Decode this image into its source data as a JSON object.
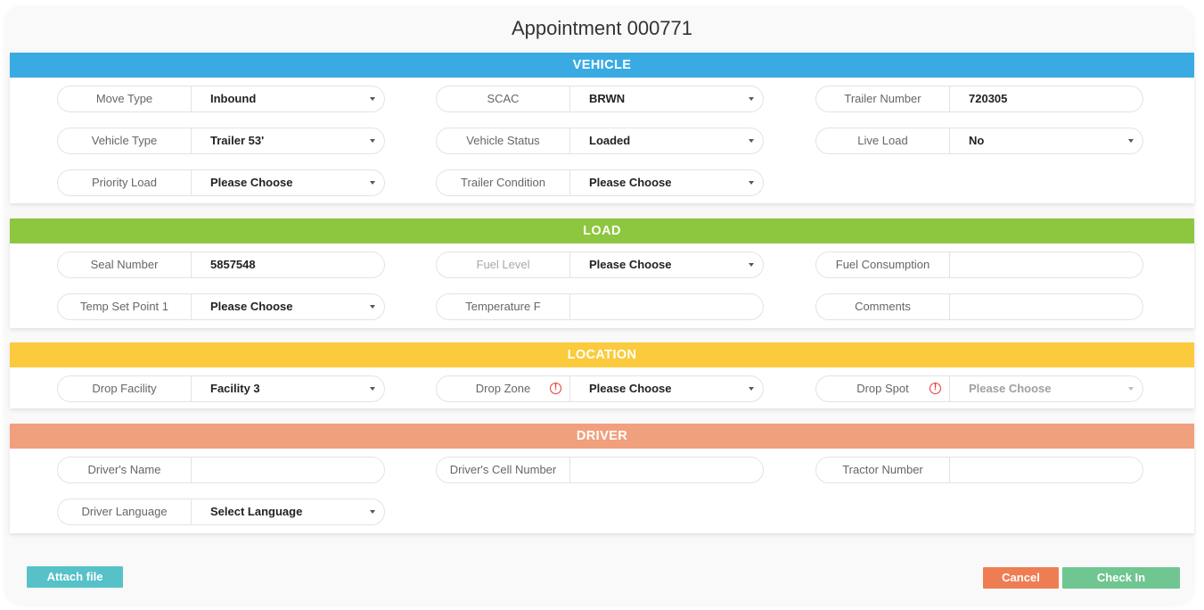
{
  "title": "Appointment 000771",
  "colors": {
    "vehicle": "#3aabe2",
    "load": "#8dc63f",
    "location": "#fbcb3d",
    "driver": "#f1a07e",
    "attach": "#56c2c8",
    "cancel": "#ef7d53",
    "checkin": "#6fc690"
  },
  "sections": {
    "vehicle": {
      "header": "VEHICLE",
      "move_type": {
        "label": "Move Type",
        "value": "Inbound"
      },
      "scac": {
        "label": "SCAC",
        "value": "BRWN"
      },
      "trailer_number": {
        "label": "Trailer Number",
        "value": "720305"
      },
      "vehicle_type": {
        "label": "Vehicle Type",
        "value": "Trailer 53'"
      },
      "vehicle_status": {
        "label": "Vehicle Status",
        "value": "Loaded"
      },
      "live_load": {
        "label": "Live Load",
        "value": "No"
      },
      "priority_load": {
        "label": "Priority Load",
        "value": "Please Choose"
      },
      "trailer_condition": {
        "label": "Trailer Condition",
        "value": "Please Choose"
      }
    },
    "load": {
      "header": "LOAD",
      "seal_number": {
        "label": "Seal Number",
        "value": "5857548"
      },
      "fuel_level": {
        "label": "Fuel Level",
        "value": "Please Choose"
      },
      "fuel_consumption": {
        "label": "Fuel Consumption",
        "value": ""
      },
      "temp_set_point": {
        "label": "Temp Set Point 1",
        "value": "Please Choose"
      },
      "temperature": {
        "label": "Temperature F",
        "value": ""
      },
      "comments": {
        "label": "Comments",
        "value": ""
      }
    },
    "location": {
      "header": "LOCATION",
      "drop_facility": {
        "label": "Drop Facility",
        "value": "Facility 3"
      },
      "drop_zone": {
        "label": "Drop Zone",
        "value": "Please Choose"
      },
      "drop_spot": {
        "label": "Drop Spot",
        "value": "Please Choose"
      }
    },
    "driver": {
      "header": "DRIVER",
      "drivers_name": {
        "label": "Driver's Name",
        "value": ""
      },
      "drivers_cell": {
        "label": "Driver's Cell Number",
        "value": ""
      },
      "tractor_number": {
        "label": "Tractor Number",
        "value": ""
      },
      "driver_language": {
        "label": "Driver Language",
        "value": "Select Language"
      }
    }
  },
  "icons": {
    "required": "exclamation-circle-icon",
    "dropdown": "caret-down-icon"
  },
  "warn_glyph": "!",
  "buttons": {
    "attach": "Attach file",
    "cancel": "Cancel",
    "checkin": "Check In"
  }
}
